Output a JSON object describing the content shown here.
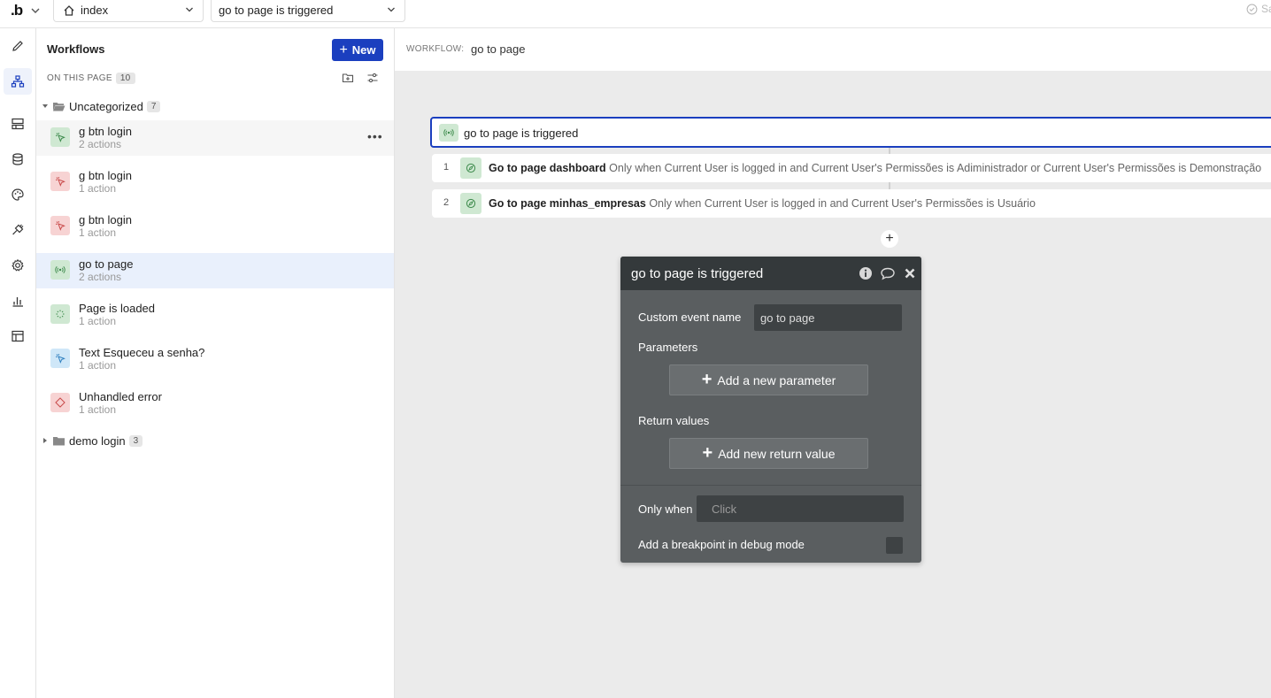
{
  "topbar": {
    "logo": ".b",
    "page_select": "index",
    "workflow_select": "go to page is triggered",
    "save_status": "Sa"
  },
  "rail": {
    "items": [
      {
        "name": "design-tab",
        "icon": "pencil-icon"
      },
      {
        "name": "workflow-tab",
        "icon": "workflow-icon",
        "active": true
      },
      {
        "name": "data-types-tab",
        "icon": "layout-icon"
      },
      {
        "name": "database-tab",
        "icon": "database-icon"
      },
      {
        "name": "styles-tab",
        "icon": "palette-icon"
      },
      {
        "name": "plugins-tab",
        "icon": "plug-icon"
      },
      {
        "name": "settings-tab",
        "icon": "gear-icon"
      },
      {
        "name": "logs-tab",
        "icon": "bar-chart-icon"
      },
      {
        "name": "templates-tab",
        "icon": "table-icon"
      }
    ]
  },
  "panel": {
    "title": "Workflows",
    "new_label": "New",
    "on_page_label": "ON THIS PAGE",
    "on_page_count": "10",
    "folder_uncategorized": {
      "name": "Uncategorized",
      "count": "7"
    },
    "folder_demo": {
      "name": "demo login",
      "count": "3"
    },
    "workflows": [
      {
        "name": "g btn login",
        "sub": "2 actions",
        "color": "green",
        "icon": "cursor-click-icon"
      },
      {
        "name": "g btn login",
        "sub": "1 action",
        "color": "red",
        "icon": "cursor-click-icon"
      },
      {
        "name": "g btn login",
        "sub": "1 action",
        "color": "red",
        "icon": "cursor-click-icon"
      },
      {
        "name": "go to page",
        "sub": "2 actions",
        "color": "green",
        "icon": "broadcast-icon"
      },
      {
        "name": "Page is loaded",
        "sub": "1 action",
        "color": "green",
        "icon": "loading-icon"
      },
      {
        "name": "Text Esqueceu a senha?",
        "sub": "1 action",
        "color": "blue",
        "icon": "cursor-click-icon"
      },
      {
        "name": "Unhandled error",
        "sub": "1 action",
        "color": "red",
        "icon": "error-diamond-icon"
      }
    ]
  },
  "canvas": {
    "workflow_label": "WORKFLOW:",
    "workflow_name": "go to page",
    "trigger": "go to page is triggered",
    "actions": [
      {
        "num": "1",
        "title": "Go to page dashboard",
        "condition": "Only when Current User is logged in and Current User's Permissões is Adiministrador or Current User's Permissões is Demonstração"
      },
      {
        "num": "2",
        "title": "Go to page minhas_empresas",
        "condition": "Only when Current User is logged in and Current User's Permissões is Usuário"
      }
    ]
  },
  "editor": {
    "title": "go to page is triggered",
    "custom_event_label": "Custom event name",
    "custom_event_value": "go to page",
    "parameters_label": "Parameters",
    "add_parameter": "Add a new parameter",
    "return_values_label": "Return values",
    "add_return": "Add new return value",
    "only_when_label": "Only when",
    "only_when_placeholder": "Click",
    "breakpoint_label": "Add a breakpoint in debug mode"
  },
  "colors": {
    "accent": "#1b3fbf",
    "editor_bg": "#5a5e60",
    "editor_header": "#34393b",
    "icon_green": "#cfe8d2",
    "icon_red": "#f7d3d3",
    "icon_blue": "#cfe7f8"
  }
}
